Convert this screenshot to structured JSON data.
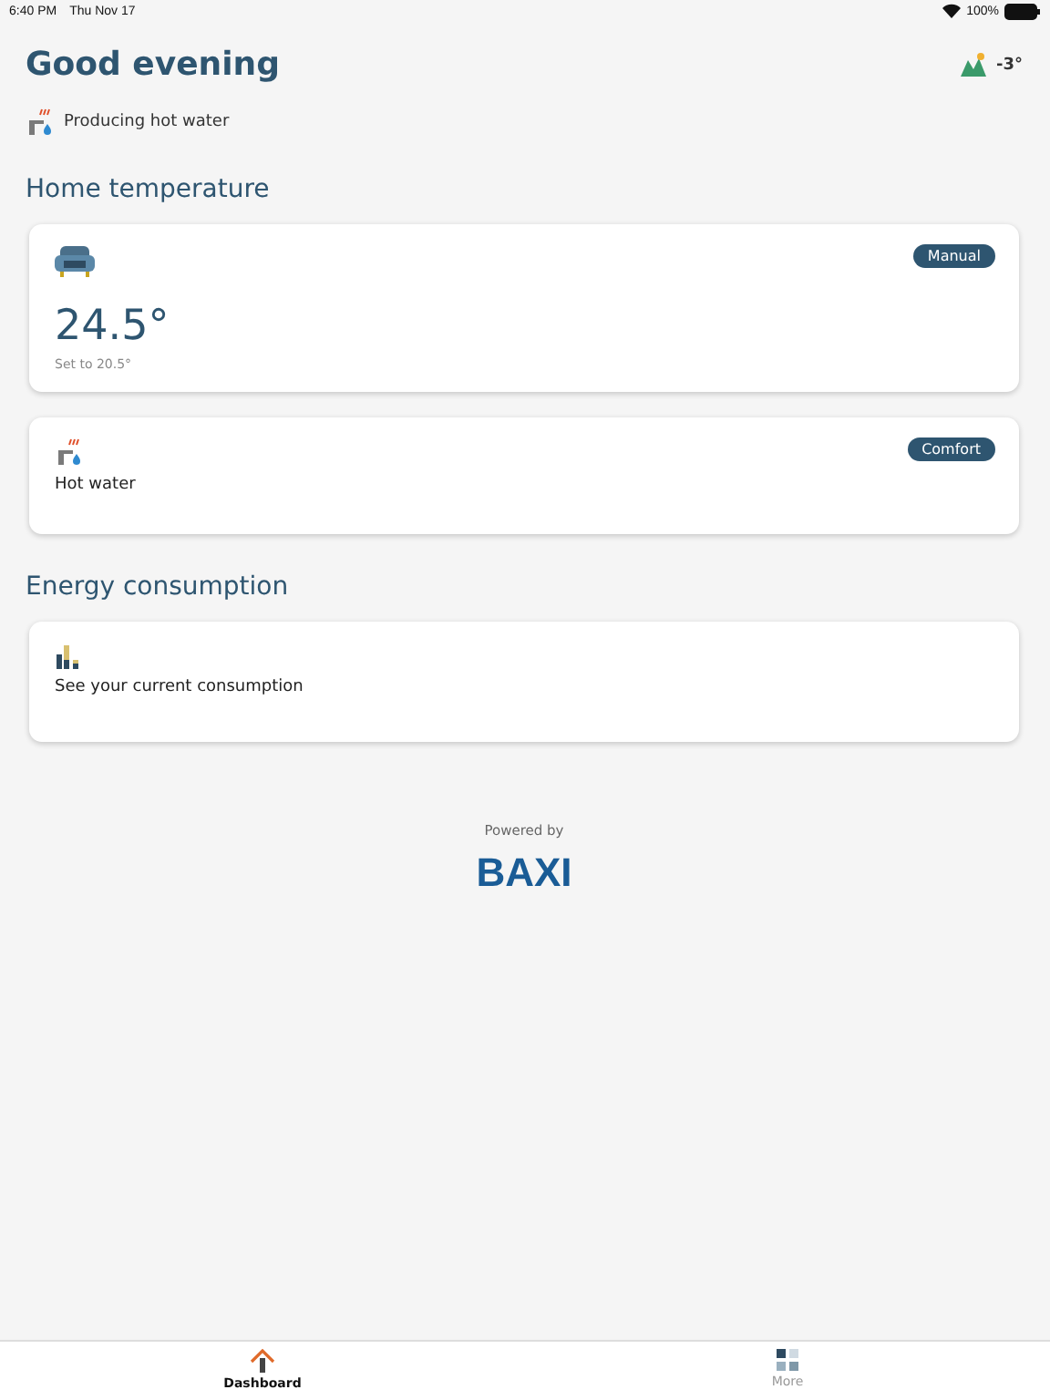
{
  "status_bar": {
    "time": "6:40 PM",
    "date": "Thu Nov 17",
    "battery": "100%"
  },
  "header": {
    "greeting": "Good evening",
    "outside_temperature": "-3°",
    "status": "Producing hot water"
  },
  "sections": [
    {
      "title": "Home temperature",
      "cards": [
        {
          "kind": "room",
          "badge": "Manual",
          "value": "24.5°",
          "subtitle": "Set to 20.5°"
        },
        {
          "kind": "water",
          "badge": "Comfort",
          "label": "Hot water"
        }
      ]
    },
    {
      "title": "Energy consumption",
      "cards": [
        {
          "kind": "energy",
          "label": "See your current consumption"
        }
      ]
    }
  ],
  "footer": {
    "caption": "Powered by",
    "brand": "BAXI"
  },
  "tabs": [
    {
      "label": "Dashboard",
      "selected": true,
      "kind": "home"
    },
    {
      "label": "More",
      "selected": false,
      "kind": "grid"
    }
  ]
}
